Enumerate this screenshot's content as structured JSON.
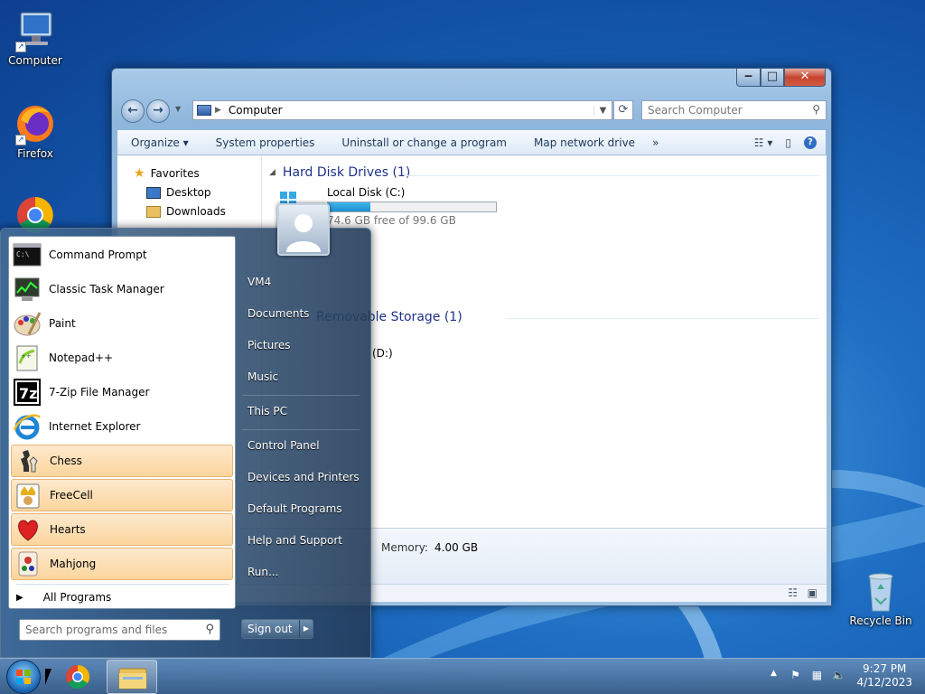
{
  "desktop": {
    "icons": [
      {
        "label": "Computer"
      },
      {
        "label": "Firefox"
      },
      {
        "label": "Recycle Bin"
      }
    ]
  },
  "explorer": {
    "address": "Computer",
    "search_placeholder": "Search Computer",
    "toolbar": {
      "organize": "Organize",
      "system_properties": "System properties",
      "uninstall": "Uninstall or change a program",
      "map_drive": "Map network drive",
      "more": "»"
    },
    "nav": {
      "favorites": "Favorites",
      "desktop": "Desktop",
      "downloads": "Downloads"
    },
    "groups": {
      "hdd": "Hard Disk Drives (1)",
      "removable": "Removable Storage (1)"
    },
    "drives": {
      "c_name": "Local Disk (C:)",
      "c_free": "74.6 GB free of 99.6 GB",
      "c_used_fraction": 0.25,
      "d_name": "(D:)"
    },
    "details": {
      "memory_label": "Memory:",
      "memory_value": "4.00 GB"
    }
  },
  "start_menu": {
    "programs": [
      {
        "label": "Command Prompt",
        "icon": "cmd-icon"
      },
      {
        "label": "Classic Task Manager",
        "icon": "task-manager-icon"
      },
      {
        "label": "Paint",
        "icon": "paint-icon"
      },
      {
        "label": "Notepad++",
        "icon": "notepadpp-icon"
      },
      {
        "label": "7-Zip File Manager",
        "icon": "7zip-icon"
      },
      {
        "label": "Internet Explorer",
        "icon": "ie-icon"
      },
      {
        "label": "Chess",
        "icon": "chess-icon"
      },
      {
        "label": "FreeCell",
        "icon": "freecell-icon"
      },
      {
        "label": "Hearts",
        "icon": "hearts-icon"
      },
      {
        "label": "Mahjong",
        "icon": "mahjong-icon"
      }
    ],
    "all_programs": "All Programs",
    "search_placeholder": "Search programs and files",
    "right": {
      "user": "VM4",
      "documents": "Documents",
      "pictures": "Pictures",
      "music": "Music",
      "this_pc": "This PC",
      "control_panel": "Control Panel",
      "devices": "Devices and Printers",
      "default_programs": "Default Programs",
      "help": "Help and Support",
      "run": "Run..."
    },
    "sign_out": "Sign out"
  },
  "taskbar": {
    "time": "9:27 PM",
    "date": "4/12/2023",
    "tray_arrow": "▲"
  }
}
